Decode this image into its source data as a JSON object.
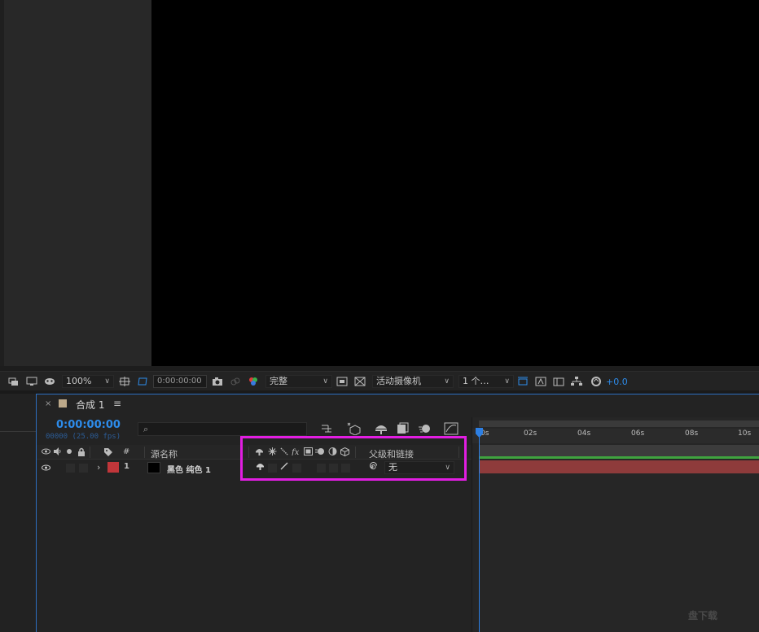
{
  "viewer_toolbar": {
    "zoom": "100%",
    "timecode": "0:00:00:00",
    "resolution": "完整",
    "camera": "活动摄像机",
    "views": "1 个…",
    "exposure": "+0.0"
  },
  "timeline": {
    "tab_close": "×",
    "tab_title": "合成 1",
    "tab_menu": "≡",
    "current_time": "0:00:00:00",
    "frame_info": "00000 (25.00 fps)",
    "search_icon": "⌕",
    "columns": {
      "hash": "#",
      "source_name": "源名称",
      "parent": "父级和链接"
    },
    "layer": {
      "index": "1",
      "name": "黑色 纯色 1",
      "switch_shy": "⊕",
      "switch_quality": "/",
      "parent_value": "无"
    },
    "ruler_labels": [
      "0s",
      "02s",
      "04s",
      "06s",
      "08s",
      "10s"
    ]
  },
  "colors": {
    "accent_blue": "#2d8ceb",
    "highlight": "#e21ee2",
    "layer_label": "#c1363a",
    "layer_bar": "#8e3b3b"
  },
  "watermark": "盘下载"
}
